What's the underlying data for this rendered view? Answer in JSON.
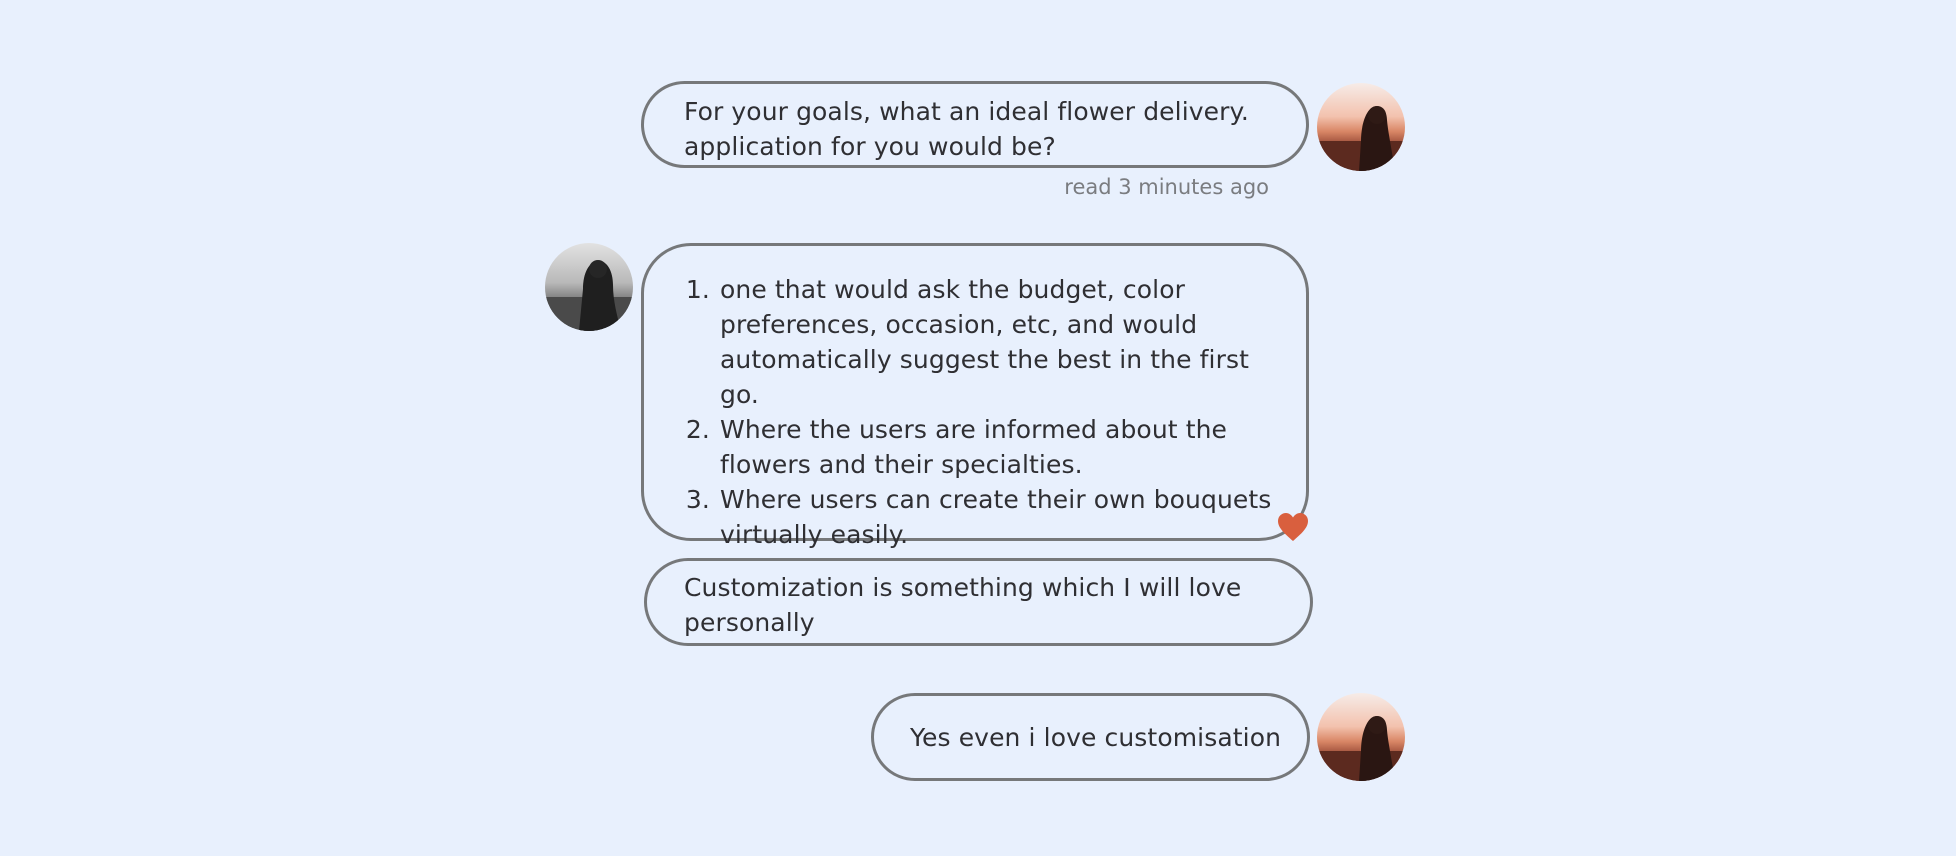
{
  "colors": {
    "background": "#e8f0fd",
    "bubble_border": "#76787a",
    "text": "#2f2f33",
    "receipt_text": "#7a7c80",
    "heart": "#d95f3e"
  },
  "messages": [
    {
      "sender": "outgoing",
      "avatar_icon": "woman-sunset-avatar",
      "text": "For your goals, what an ideal flower delivery. application for you would be?",
      "receipt": "read 3 minutes ago"
    },
    {
      "sender": "incoming",
      "avatar_icon": "woman-grayscale-avatar",
      "list_items": [
        "one that would ask the budget, color preferences, occasion, etc, and would automatically suggest the best in the first go.",
        "Where the users are informed about the flowers and their specialties.",
        "Where users can create their own bouquets virtually easily."
      ],
      "reaction_icon": "heart-icon"
    },
    {
      "sender": "incoming",
      "text": "Customization is something which I will love personally"
    },
    {
      "sender": "outgoing",
      "avatar_icon": "woman-sunset-avatar",
      "text": "Yes even i love customisation"
    }
  ]
}
